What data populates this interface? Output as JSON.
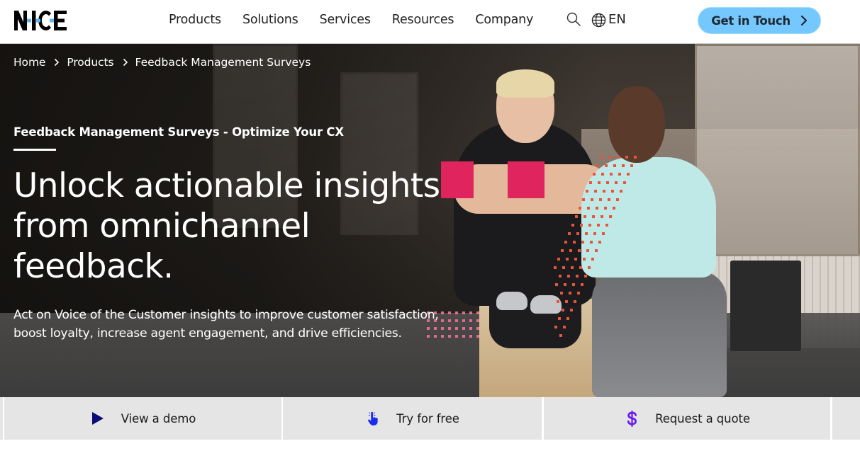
{
  "header": {
    "logo_text": "NICE",
    "nav": [
      {
        "label": "Products"
      },
      {
        "label": "Solutions"
      },
      {
        "label": "Services"
      },
      {
        "label": "Resources"
      },
      {
        "label": "Company"
      }
    ],
    "search_icon": "search-icon",
    "language": {
      "icon": "globe-icon",
      "label": "EN"
    },
    "cta": {
      "label": "Get in Touch",
      "icon": "chevron-right-icon"
    }
  },
  "hero": {
    "breadcrumb": [
      {
        "label": "Home"
      },
      {
        "label": "Products"
      },
      {
        "label": "Feedback Management Surveys"
      }
    ],
    "eyebrow": "Feedback Management Surveys - Optimize Your CX",
    "headline_lines": [
      "Unlock actionable insights",
      "from omnichannel",
      "feedback."
    ],
    "subtext": "Act on Voice of the Customer insights to improve customer satisfaction, boost loyalty, increase agent engagement, and drive efficiencies.",
    "image_alt": "Two women smiling, sitting on a plyo box in a gym"
  },
  "actions": [
    {
      "label": "View a demo",
      "icon": "play-icon"
    },
    {
      "label": "Try for free",
      "icon": "pointer-hand-icon"
    },
    {
      "label": "Request a quote",
      "icon": "dollar-icon"
    }
  ],
  "colors": {
    "cta_bg": "#75c8fd",
    "accent_pink": "#e0245e",
    "dot_orange": "#e8553a",
    "dot_pink": "#e06a92",
    "action_bar_bg": "#e5e5e5",
    "play_icon": "#0b0b7a",
    "hand_icon": "#1a2cf0",
    "dollar_icon": "#6a1cf5",
    "logo_dots": "#5cb8ec"
  }
}
